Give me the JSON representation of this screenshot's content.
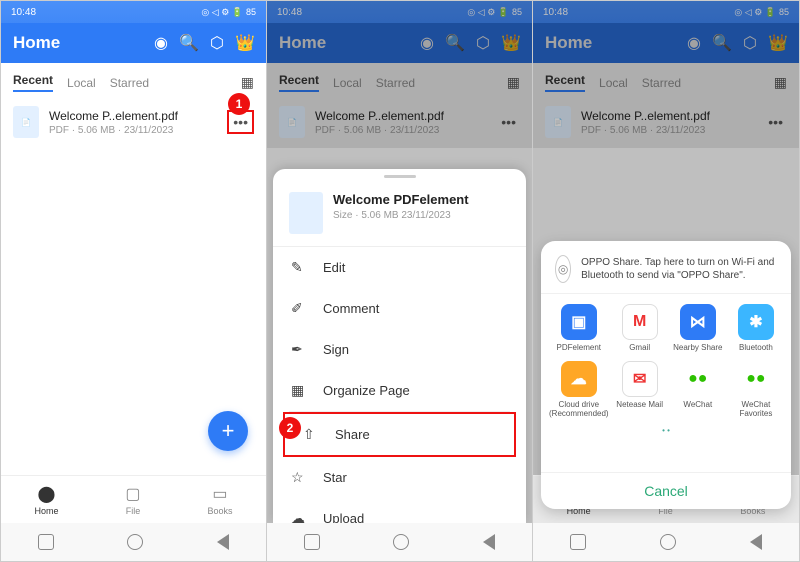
{
  "status": {
    "time": "10:48",
    "battery": "85"
  },
  "header": {
    "title": "Home"
  },
  "tabs": {
    "recent": "Recent",
    "local": "Local",
    "starred": "Starred"
  },
  "file": {
    "name": "Welcome P..element.pdf",
    "meta": "PDF · 5.06 MB · 23/11/2023"
  },
  "nav": {
    "home": "Home",
    "file": "File",
    "books": "Books"
  },
  "callouts": {
    "one": "1",
    "two": "2"
  },
  "sheet": {
    "file_name": "Welcome PDFelement",
    "file_meta": "Size · 5.06 MB  23/11/2023",
    "edit": "Edit",
    "comment": "Comment",
    "sign": "Sign",
    "organize": "Organize Page",
    "share": "Share",
    "star": "Star",
    "upload": "Upload"
  },
  "share": {
    "oppo": "OPPO Share. Tap here to turn on Wi-Fi and Bluetooth to send via \"OPPO Share\".",
    "apps": {
      "pdfelement": "PDFelement",
      "gmail": "Gmail",
      "nearby": "Nearby Share",
      "bluetooth": "Bluetooth",
      "cloud": "Cloud drive (Recommended)",
      "netease": "Netease Mail",
      "wechat": "WeChat",
      "wechat_fav": "WeChat Favorites"
    },
    "cancel": "Cancel"
  }
}
